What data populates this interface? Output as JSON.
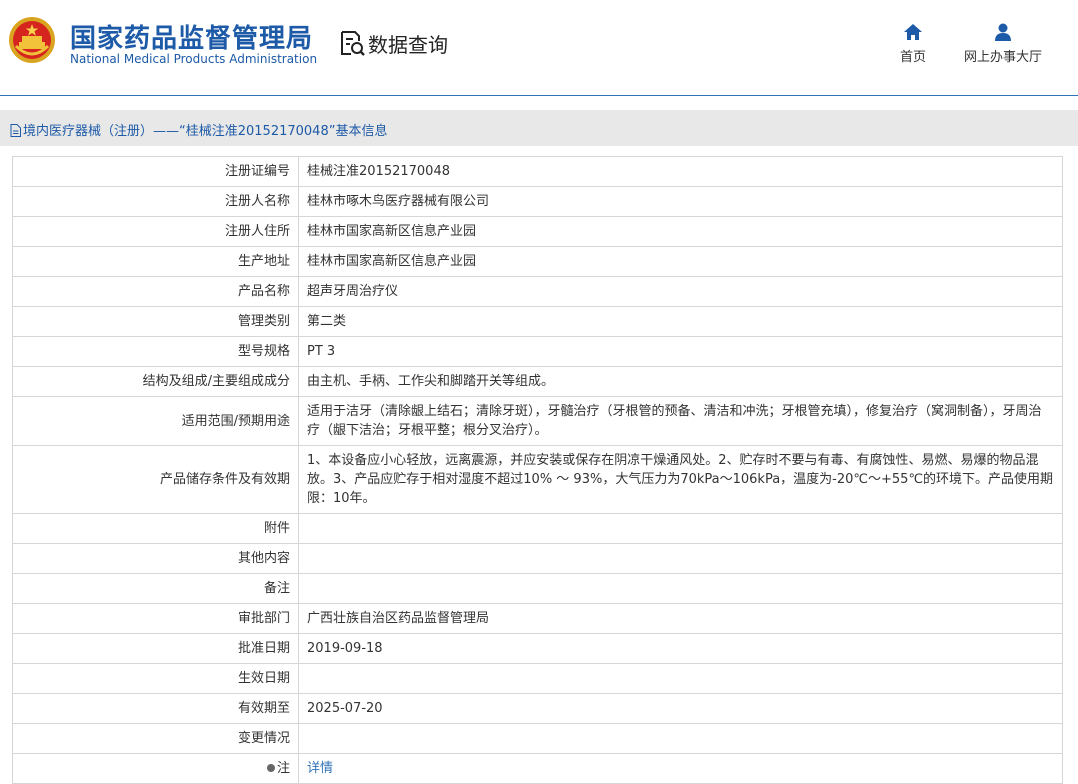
{
  "header": {
    "title": "国家药品监督管理局",
    "subtitle": "National Medical Products Administration",
    "query_label": "数据查询",
    "nav": [
      {
        "label": "首页",
        "icon": "home-icon"
      },
      {
        "label": "网上办事大厅",
        "icon": "user-icon"
      }
    ]
  },
  "breadcrumb": {
    "text": "境内医疗器械（注册）——“桂械注准20152170048”基本信息"
  },
  "rows": [
    {
      "label": "注册证编号",
      "value": "桂械注准20152170048"
    },
    {
      "label": "注册人名称",
      "value": "桂林市啄木鸟医疗器械有限公司"
    },
    {
      "label": "注册人住所",
      "value": "桂林市国家高新区信息产业园"
    },
    {
      "label": "生产地址",
      "value": "桂林市国家高新区信息产业园"
    },
    {
      "label": "产品名称",
      "value": "超声牙周治疗仪"
    },
    {
      "label": "管理类别",
      "value": "第二类"
    },
    {
      "label": "型号规格",
      "value": "PT 3"
    },
    {
      "label": "结构及组成/主要组成成分",
      "value": "由主机、手柄、工作尖和脚踏开关等组成。"
    },
    {
      "label": "适用范围/预期用途",
      "value": "适用于洁牙（清除龈上结石；清除牙斑），牙髓治疗（牙根管的预备、清洁和冲洗；牙根管充填），修复治疗（窝洞制备），牙周治疗（龈下洁治；牙根平整；根分叉治疗）。"
    },
    {
      "label": "产品储存条件及有效期",
      "value": "1、本设备应小心轻放，远离震源，并应安装或保存在阴凉干燥通风处。2、贮存时不要与有毒、有腐蚀性、易燃、易爆的物品混放。3、产品应贮存于相对湿度不超过10% ～ 93%，大气压力为70kPa～106kPa，温度为-20℃～+55℃的环境下。产品使用期限：10年。"
    },
    {
      "label": "附件",
      "value": ""
    },
    {
      "label": "其他内容",
      "value": ""
    },
    {
      "label": "备注",
      "value": ""
    },
    {
      "label": "审批部门",
      "value": "广西壮族自治区药品监督管理局"
    },
    {
      "label": "批准日期",
      "value": "2019-09-18"
    },
    {
      "label": "生效日期",
      "value": ""
    },
    {
      "label": "有效期至",
      "value": "2025-07-20"
    },
    {
      "label": "变更情况",
      "value": ""
    }
  ],
  "note": {
    "label": "注",
    "link_text": "详情"
  },
  "colors": {
    "brand_blue": "#1d5aa7",
    "link_blue": "#2f73b6",
    "bar_gray": "#e8e8e8",
    "border_gray": "#d6d6d6"
  }
}
